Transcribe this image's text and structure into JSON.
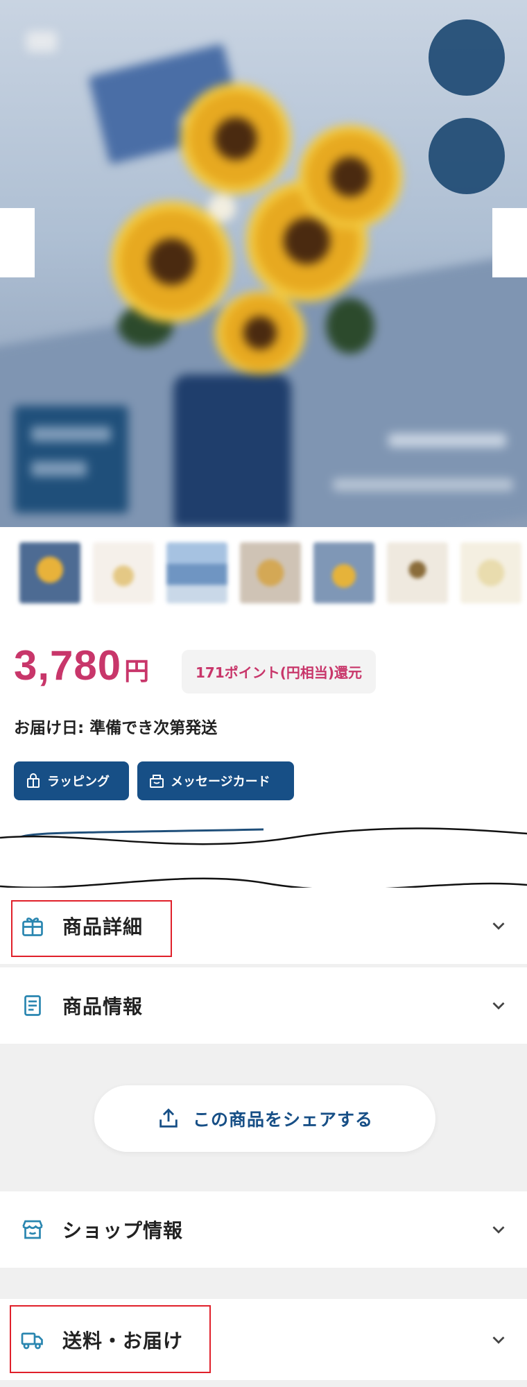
{
  "hero": {
    "badges": [
      "",
      ""
    ],
    "tag_text": ""
  },
  "thumbnails": [
    "thumb-1",
    "thumb-2",
    "thumb-3",
    "thumb-4",
    "thumb-5",
    "thumb-6",
    "thumb-7",
    "thumb-8"
  ],
  "price": {
    "amount": "3,780",
    "unit": "円",
    "points_text": "171ポイント(円相当)還元"
  },
  "delivery_text": "お届け日: 準備でき次第発送",
  "options": {
    "wrapping_label": "ラッピング",
    "message_card_label": "メッセージカード"
  },
  "accordions": {
    "detail_title": "商品詳細",
    "info_title": "商品情報",
    "shop_title": "ショップ情報",
    "shipping_title": "送料・お届け"
  },
  "share": {
    "label": "この商品をシェアする"
  },
  "colors": {
    "brand_blue": "#174f86",
    "price_pink": "#c8366a",
    "icon_teal": "#2a86b0",
    "annotation_red": "#e0202a"
  }
}
